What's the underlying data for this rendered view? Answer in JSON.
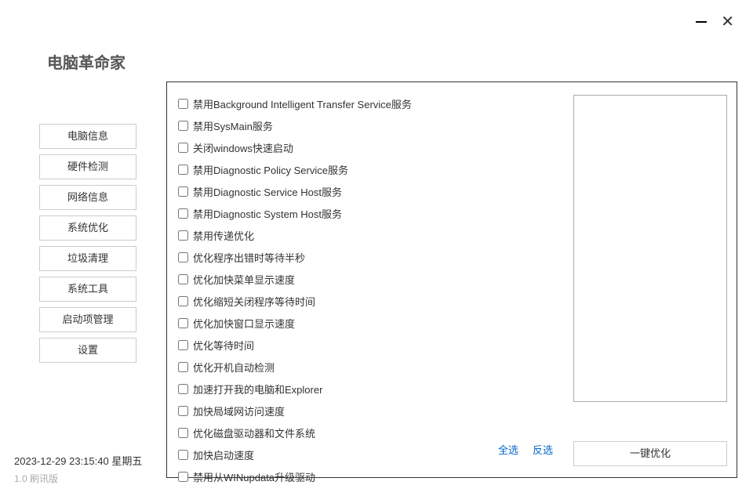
{
  "app_title": "电脑革命家",
  "window": {
    "minimize": "—",
    "close": "✕"
  },
  "sidebar": {
    "items": [
      {
        "label": "电脑信息"
      },
      {
        "label": "硬件检测"
      },
      {
        "label": "网络信息"
      },
      {
        "label": "系统优化"
      },
      {
        "label": "垃圾清理"
      },
      {
        "label": "系统工具"
      },
      {
        "label": "启动项管理"
      },
      {
        "label": "设置"
      }
    ]
  },
  "options": [
    {
      "label": "禁用Background Intelligent Transfer Service服务"
    },
    {
      "label": "禁用SysMain服务"
    },
    {
      "label": "关闭windows快速启动"
    },
    {
      "label": "禁用Diagnostic Policy Service服务"
    },
    {
      "label": "禁用Diagnostic Service Host服务"
    },
    {
      "label": "禁用Diagnostic System Host服务"
    },
    {
      "label": "禁用传递优化"
    },
    {
      "label": "优化程序出错时等待半秒"
    },
    {
      "label": "优化加快菜单显示速度"
    },
    {
      "label": "优化缩短关闭程序等待时间"
    },
    {
      "label": "优化加快窗口显示速度"
    },
    {
      "label": "优化等待时间"
    },
    {
      "label": "优化开机自动检测"
    },
    {
      "label": "加速打开我的电脑和Explorer"
    },
    {
      "label": "加快局域网访问速度"
    },
    {
      "label": "优化磁盘驱动器和文件系统"
    },
    {
      "label": "加快启动速度"
    },
    {
      "label": "禁用从WINupdata升级驱动"
    }
  ],
  "select_all": "全选",
  "invert_select": "反选",
  "optimize_button": "一键优化",
  "footer": {
    "datetime": "2023-12-29 23:15:40  星期五",
    "version": "1.0  刷讯版"
  }
}
